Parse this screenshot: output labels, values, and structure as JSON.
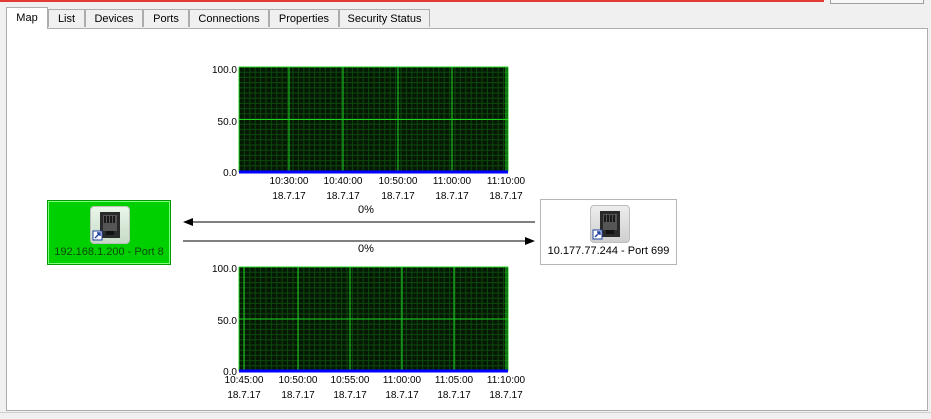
{
  "tabs": [
    {
      "label": "Map",
      "active": true
    },
    {
      "label": "List"
    },
    {
      "label": "Devices"
    },
    {
      "label": "Ports"
    },
    {
      "label": "Connections"
    },
    {
      "label": "Properties"
    },
    {
      "label": "Security Status"
    }
  ],
  "map": {
    "left_node": {
      "label": "192.168.1.200 - Port 8",
      "status_color": "#00d000",
      "icon": "ethernet-port-icon"
    },
    "right_node": {
      "label": "10.177.77.244 - Port 699",
      "icon": "ethernet-port-icon"
    },
    "arrow_top_pct": "0%",
    "arrow_bottom_pct": "0%"
  },
  "graphs": {
    "top": {
      "y_ticks": [
        "100.0",
        "50.0",
        "0.0"
      ],
      "x_times": [
        "10:30:00",
        "10:40:00",
        "10:50:00",
        "11:00:00",
        "11:10:00"
      ],
      "x_dates": [
        "18.7.17",
        "18.7.17",
        "18.7.17",
        "18.7.17",
        "18.7.17"
      ]
    },
    "bottom": {
      "y_ticks": [
        "100.0",
        "50.0",
        "0.0"
      ],
      "x_times": [
        "10:45:00",
        "10:50:00",
        "10:55:00",
        "11:00:00",
        "11:05:00",
        "11:10:00"
      ],
      "x_dates": [
        "18.7.17",
        "18.7.17",
        "18.7.17",
        "18.7.17",
        "18.7.17",
        "18.7.17"
      ]
    }
  },
  "chart_data": [
    {
      "type": "line",
      "ylim": [
        0,
        100
      ],
      "x": [
        "10:30:00",
        "10:40:00",
        "10:50:00",
        "11:00:00",
        "11:10:00"
      ],
      "series": [
        {
          "values": [
            0,
            0,
            0,
            0,
            0
          ]
        }
      ],
      "grid": true
    },
    {
      "type": "line",
      "ylim": [
        0,
        100
      ],
      "x": [
        "10:45:00",
        "10:50:00",
        "10:55:00",
        "11:00:00",
        "11:05:00",
        "11:10:00"
      ],
      "series": [
        {
          "values": [
            0,
            0,
            0,
            0,
            0,
            0
          ]
        }
      ],
      "grid": true
    }
  ],
  "colors": {
    "graph_bg": "#061706",
    "grid_minor": "#0c4a0c",
    "grid_major": "#1fd41f",
    "baseline": "#0000ff"
  }
}
